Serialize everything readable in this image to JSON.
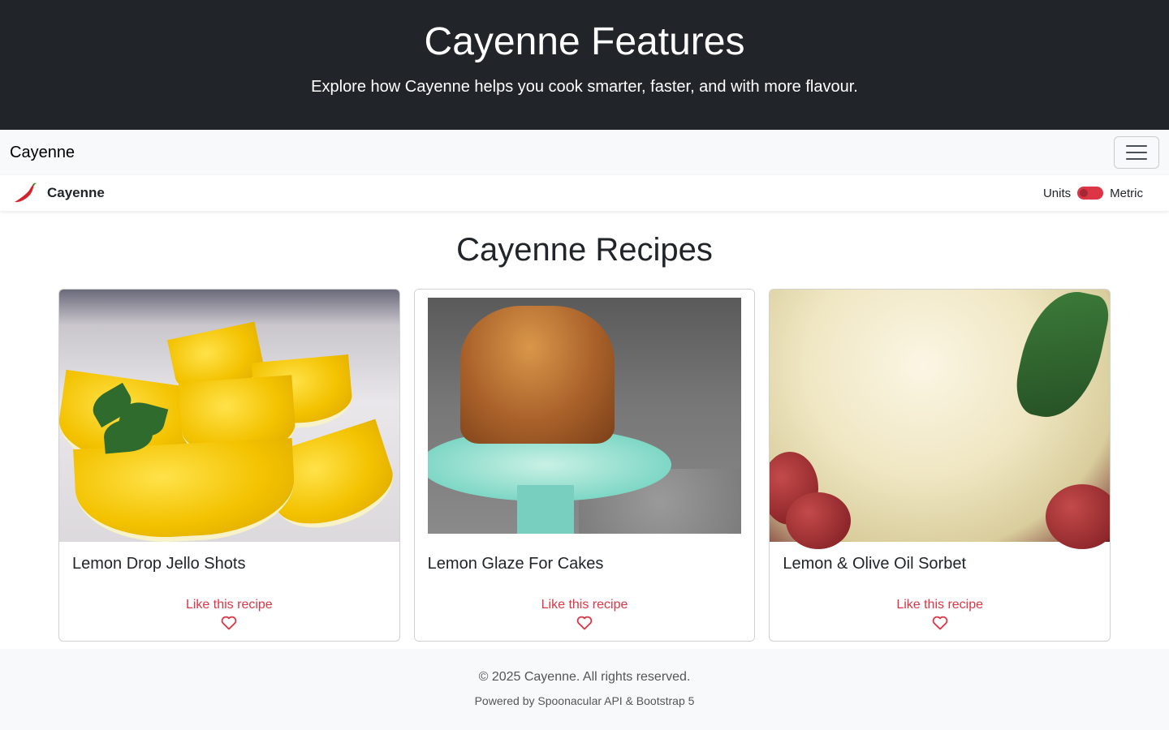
{
  "hero": {
    "title": "Cayenne Features",
    "subtitle": "Explore how Cayenne helps you cook smarter, faster, and with more flavour."
  },
  "navbar": {
    "brand": "Cayenne",
    "toggler_icon": "hamburger-menu-icon"
  },
  "subbar": {
    "logo_icon": "chili-pepper-icon",
    "brand": "Cayenne",
    "units_label": "Units",
    "units_value": "Metric",
    "units_toggle_on": true
  },
  "main": {
    "heading": "Cayenne Recipes",
    "recipes": [
      {
        "title": "Lemon Drop Jello Shots",
        "like_label": "Like this recipe",
        "like_icon": "heart-outline-icon"
      },
      {
        "title": "Lemon Glaze For Cakes",
        "like_label": "Like this recipe",
        "like_icon": "heart-outline-icon"
      },
      {
        "title": "Lemon & Olive Oil Sorbet",
        "like_label": "Like this recipe",
        "like_icon": "heart-outline-icon"
      }
    ]
  },
  "footer": {
    "copyright": "© 2025 Cayenne. All rights reserved.",
    "powered_by": "Powered by Spoonacular API & Bootstrap 5"
  },
  "colors": {
    "hero_bg": "#212529",
    "accent": "#dc3545",
    "navbar_bg": "#f8f9fa"
  }
}
